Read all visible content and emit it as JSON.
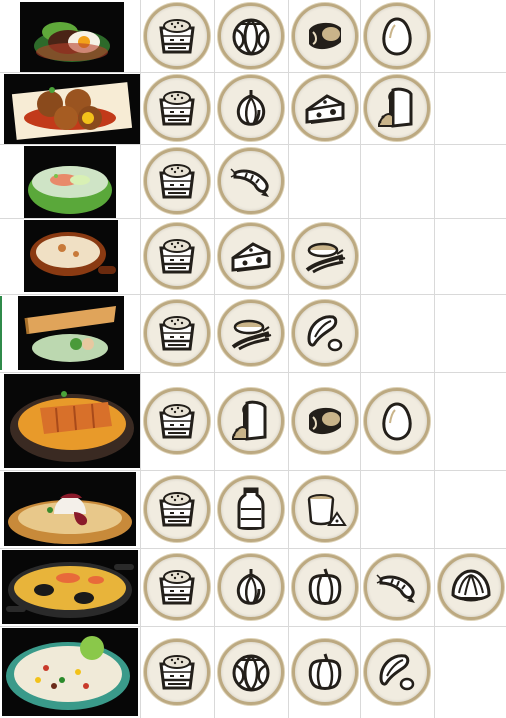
{
  "colors": {
    "grid_line": "#d9d9d9",
    "token_fill": "#f1ece0",
    "token_ring": "#bca981",
    "icon_ink": "#231f1a",
    "icon_tan": "#b49a6b",
    "dish_bg": "#070707"
  },
  "recipes": [
    {
      "dish": "dish-hamburg-steak-with-egg",
      "ingredients": [
        "rice-icon",
        "cabbage-icon",
        "meat-icon",
        "egg-icon"
      ]
    },
    {
      "dish": "dish-fried-croquettes",
      "ingredients": [
        "rice-icon",
        "onion-icon",
        "cheese-icon",
        "bread-icon"
      ]
    },
    {
      "dish": "dish-shrimp-rice-porridge",
      "ingredients": [
        "rice-icon",
        "shrimp-icon"
      ]
    },
    {
      "dish": "dish-cheese-rice-gratin",
      "ingredients": [
        "rice-icon",
        "cheese-icon",
        "spices-icon"
      ]
    },
    {
      "dish": "dish-dosa",
      "ingredients": [
        "rice-icon",
        "spices-icon",
        "beans-icon"
      ]
    },
    {
      "dish": "dish-katsu-curry",
      "ingredients": [
        "rice-icon",
        "bread-icon",
        "meat-icon",
        "egg-icon"
      ]
    },
    {
      "dish": "dish-rice-pudding",
      "ingredients": [
        "rice-icon",
        "milk-icon",
        "sugar-icon"
      ]
    },
    {
      "dish": "dish-paella",
      "ingredients": [
        "rice-icon",
        "onion-icon",
        "bell-pepper-icon",
        "shrimp-icon",
        "clam-icon"
      ]
    },
    {
      "dish": "dish-rice-salad",
      "ingredients": [
        "rice-icon",
        "cabbage-icon",
        "bell-pepper-icon",
        "beans-icon"
      ]
    }
  ]
}
